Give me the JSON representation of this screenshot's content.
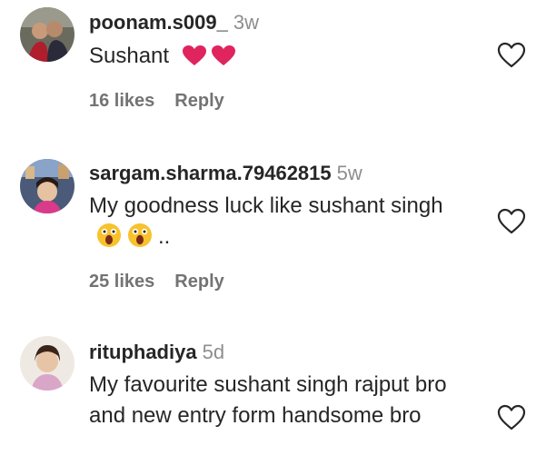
{
  "comments": [
    {
      "username": "poonam.s009_",
      "time": "3w",
      "text": "Sushant",
      "emoji_suffix": [
        "red-heart",
        "red-heart"
      ],
      "text_after": "",
      "likes": "16 likes",
      "reply": "Reply"
    },
    {
      "username": "sargam.sharma.79462815",
      "time": "5w",
      "text": "My goodness luck like sushant singh",
      "emoji_suffix": [
        "face-screaming",
        "face-screaming"
      ],
      "text_after": "..",
      "likes": "25 likes",
      "reply": "Reply"
    },
    {
      "username": "rituphadiya",
      "time": "5d",
      "text": "My favourite sushant singh rajput bro and new entry form handsome bro",
      "emoji_suffix": [],
      "text_after": "",
      "likes": "",
      "reply": ""
    }
  ],
  "icons": {
    "like": "heart-outline-icon",
    "red_heart": "red-heart-emoji",
    "shocked": "face-screaming-emoji"
  },
  "colors": {
    "text": "#262626",
    "muted": "#8e8e8e",
    "meta": "#737373",
    "heart_emoji": "#e0245e"
  }
}
